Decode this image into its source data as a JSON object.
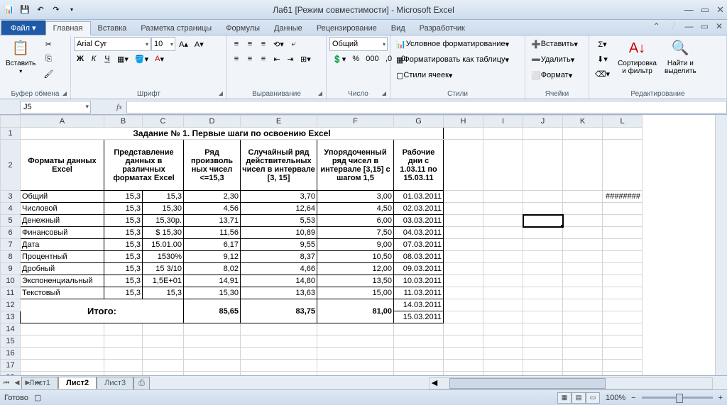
{
  "title": "Ла61  [Режим совместимости]  -  Microsoft Excel",
  "tabs": {
    "file": "Файл",
    "home": "Главная",
    "insert": "Вставка",
    "layout": "Разметка страницы",
    "formulas": "Формулы",
    "data": "Данные",
    "review": "Рецензирование",
    "view": "Вид",
    "dev": "Разработчик"
  },
  "ribbon": {
    "clipboard": {
      "paste": "Вставить",
      "label": "Буфер обмена"
    },
    "font": {
      "name": "Arial Cyr",
      "size": "10",
      "bold": "Ж",
      "italic": "К",
      "under": "Ч",
      "label": "Шрифт"
    },
    "align": {
      "label": "Выравнивание"
    },
    "number": {
      "general": "Общий",
      "label": "Число"
    },
    "styles": {
      "cond": "Условное форматирование",
      "table": "Форматировать как таблицу",
      "cell": "Стили ячеек",
      "label": "Стили"
    },
    "cells": {
      "insert": "Вставить",
      "delete": "Удалить",
      "format": "Формат",
      "label": "Ячейки"
    },
    "editing": {
      "sort": "Сортировка\nи фильтр",
      "find": "Найти и\nвыделить",
      "label": "Редактирование"
    }
  },
  "namebox": "J5",
  "fx": "fx",
  "cols": [
    "A",
    "B",
    "C",
    "D",
    "E",
    "F",
    "G",
    "H",
    "I",
    "J",
    "K",
    "L"
  ],
  "data": {
    "title": "Задание № 1. Первые шаги по освоению Excel",
    "h": {
      "a": "Форматы данных  Excel",
      "bc": "Представление данных в различных форматах Excel",
      "d": "Ряд произволь\nных чисел <=15,3",
      "e": "Случайный ряд действительных чисел в интервале [3, 15]",
      "f": "Упорядоченный ряд чисел в интервале [3,15] с шагом 1,5",
      "g": "Рабочие дни с 1.03.11 по 15.03.11"
    },
    "rows": [
      {
        "a": "Общий",
        "b": "15,3",
        "c": "15,3",
        "d": "2,30",
        "e": "3,70",
        "f": "3,00",
        "g": "01.03.2011"
      },
      {
        "a": "Числовой",
        "b": "15,3",
        "c": "15,30",
        "d": "4,56",
        "e": "12,64",
        "f": "4,50",
        "g": "02.03.2011"
      },
      {
        "a": "Денежный",
        "b": "15,3",
        "c": "15,30р.",
        "d": "13,71",
        "e": "5,53",
        "f": "6,00",
        "g": "03.03.2011"
      },
      {
        "a": "Финансовый",
        "b": "15,3",
        "c": "$     15,30",
        "d": "11,56",
        "e": "10,89",
        "f": "7,50",
        "g": "04.03.2011"
      },
      {
        "a": "Дата",
        "b": "15,3",
        "c": "15.01.00",
        "d": "6,17",
        "e": "9,55",
        "f": "9,00",
        "g": "07.03.2011"
      },
      {
        "a": "Процентный",
        "b": "15,3",
        "c": "1530%",
        "d": "9,12",
        "e": "8,37",
        "f": "10,50",
        "g": "08.03.2011"
      },
      {
        "a": "Дробный",
        "b": "15,3",
        "c": "15   3/10",
        "d": "8,02",
        "e": "4,66",
        "f": "12,00",
        "g": "09.03.2011"
      },
      {
        "a": "Экспоненциальный",
        "b": "15,3",
        "c": "1,5E+01",
        "d": "14,91",
        "e": "14,80",
        "f": "13,50",
        "g": "10.03.2011"
      },
      {
        "a": "Текстовый",
        "b": "15,3",
        "c": "15,3",
        "d": "15,30",
        "e": "13,63",
        "f": "15,00",
        "g": "11.03.2011"
      }
    ],
    "total": {
      "label": "Итого:",
      "d": "85,65",
      "e": "83,75",
      "f": "81,00",
      "g12": "14.03.2011",
      "g13": "15.03.2011"
    },
    "overflow": "########"
  },
  "sheets": {
    "s1": "Лист1",
    "s2": "Лист2",
    "s3": "Лист3"
  },
  "status": {
    "ready": "Готово",
    "zoom": "100%"
  }
}
